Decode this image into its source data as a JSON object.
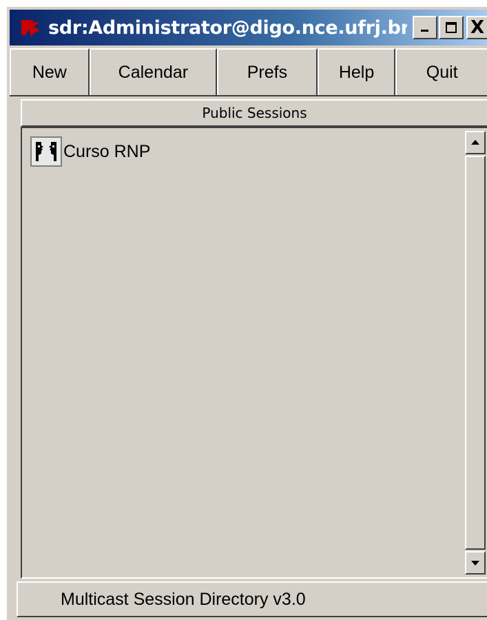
{
  "window": {
    "title": "sdr:Administrator@digo.nce.ufrj.br",
    "logo_icon": "tk-feather-icon",
    "controls": {
      "minimize_icon": "minimize-icon",
      "maximize_icon": "maximize-icon",
      "close_label": "X"
    }
  },
  "menu": {
    "items": [
      {
        "label": "New"
      },
      {
        "label": "Calendar"
      },
      {
        "label": "Prefs"
      },
      {
        "label": "Help"
      },
      {
        "label": "Quit"
      }
    ]
  },
  "sessions": {
    "header": "Public Sessions",
    "items": [
      {
        "label": "Curso RNP",
        "icon": "session-people-icon"
      }
    ],
    "scrollbar": {
      "up_icon": "arrow-up-icon",
      "down_icon": "arrow-down-icon"
    }
  },
  "status": {
    "text": "Multicast Session Directory v3.0"
  },
  "colors": {
    "face": "#d4d0c8",
    "titlebar_start": "#0a246a",
    "titlebar_end": "#a6caf0",
    "logo": "#cc0000"
  }
}
